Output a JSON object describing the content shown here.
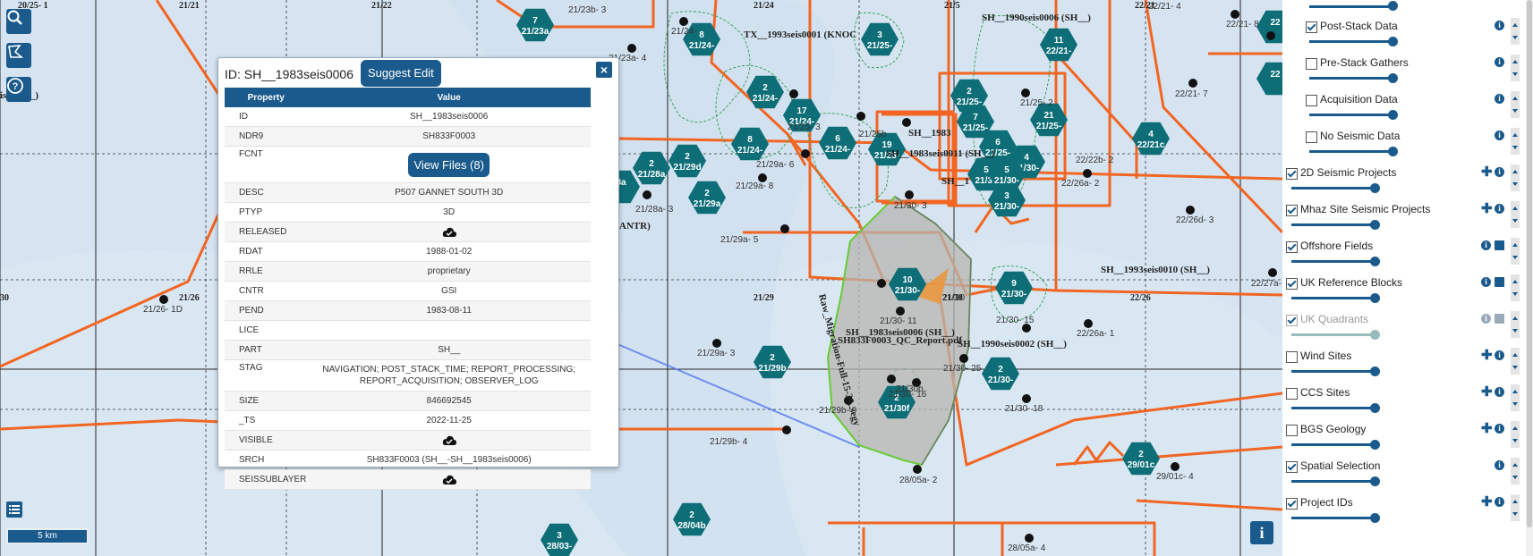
{
  "popup": {
    "title": "ID: SH__1983seis0006",
    "suggest_label": "Suggest Edit",
    "close_label": "×",
    "col_property": "Property",
    "col_value": "Value",
    "view_files_label": "View Files (8)",
    "rows": {
      "id": {
        "k": "ID",
        "v": "SH__1983seis0006"
      },
      "ndr9": {
        "k": "NDR9",
        "v": "SH833F0003"
      },
      "fcnt": {
        "k": "FCNT"
      },
      "desc": {
        "k": "DESC",
        "v": "P507 GANNET SOUTH 3D"
      },
      "ptyp": {
        "k": "PTYP",
        "v": "3D"
      },
      "released": {
        "k": "RELEASED"
      },
      "rdat": {
        "k": "RDAT",
        "v": "1988-01-02"
      },
      "rrle": {
        "k": "RRLE",
        "v": "proprietary"
      },
      "cntr": {
        "k": "CNTR",
        "v": "GSI"
      },
      "pend": {
        "k": "PEND",
        "v": "1983-08-11"
      },
      "lice": {
        "k": "LICE",
        "v": ""
      },
      "part": {
        "k": "PART",
        "v": "SH__"
      },
      "stag": {
        "k": "STAG",
        "v": "NAVIGATION; POST_STACK_TIME; REPORT_PROCESSING; REPORT_ACQUISITION; OBSERVER_LOG"
      },
      "size": {
        "k": "SIZE",
        "v": "846692545"
      },
      "ts": {
        "k": "_TS",
        "v": "2022-11-25"
      },
      "visible": {
        "k": "VISIBLE"
      },
      "srch": {
        "k": "SRCH",
        "v": "SH833F0003 (SH__-SH__1983seis0006)"
      },
      "seissublayer": {
        "k": "SEISSUBLAYER"
      }
    }
  },
  "layers": {
    "post_stack": "Post-Stack Data",
    "pre_stack": "Pre-Stack Gathers",
    "acquisition": "Acquisition Data",
    "no_seismic": "No Seismic Data",
    "seismic_2d": "2D Seismic Projects",
    "mhaz": "Mhaz Site Seismic Projects",
    "offshore": "Offshore Fields",
    "uk_blocks": "UK Reference Blocks",
    "uk_quadrants": "UK Quadrants",
    "wind": "Wind Sites",
    "ccs": "CCS Sites",
    "bgs": "BGS Geology",
    "spatial": "Spatial Selection",
    "project_ids": "Project IDs"
  },
  "map": {
    "scale_label": "5 km",
    "info_label": "i",
    "grid_labels": [
      "21/21",
      "21/22",
      "21/24",
      "21/5",
      "22/21",
      "21/26",
      "21/29",
      "21/30",
      "22/26",
      "20/25- 1",
      "30"
    ],
    "survey_labels": [
      "SH__1990seis0006 (SH__)",
      "TX__1993seis0001 (KNOC",
      "SH__1983seis0011 (SH__)",
      "SH__1993seis0010 (SH__)",
      "SH__1990seis0002 (SH__)",
      "1 (ANTR)",
      "SH833F0003_QC_Report.pdf",
      "SH__1983seis0006 (SH__)",
      "Raw_Migration-Full-15-30..segy",
      "SH__1983",
      "is (SH__)",
      "SH__1"
    ],
    "well_labels": [
      "21/24-",
      "21/23a- 4",
      "21/25- 3",
      "21/25b",
      "21/29a- 6",
      "21/29a- 8",
      "21/28a- 3",
      "21/29a- 5",
      "21/30- 3",
      "21/30- 11",
      "21/30- 16",
      "21/30b",
      "21/30- 25",
      "21/29b- 9",
      "21/29b- 4",
      "21/29a- 3",
      "21/30- 15",
      "21/30- 18",
      "28/05a- 2",
      "28/05a- 4",
      "21/26- 1D",
      "22/22b- 2",
      "22/26a- 2",
      "22/26d- 3",
      "22/26a- 1",
      "22/27a-",
      "22/21- 7",
      "22/21- 8",
      "22/21- 4",
      "21/25- 2",
      "29/01c- 4",
      "21/23b- 3",
      "21/30"
    ],
    "hex_markers": [
      {
        "n": "7",
        "t": "21/23a"
      },
      {
        "n": "8",
        "t": "21/24-"
      },
      {
        "n": "3",
        "t": "21/25-"
      },
      {
        "n": "11",
        "t": "22/21-"
      },
      {
        "n": "2",
        "t": "21/24-"
      },
      {
        "n": "17",
        "t": "21/24-"
      },
      {
        "n": "8",
        "t": "21/24-"
      },
      {
        "n": "6",
        "t": "21/24-"
      },
      {
        "n": "19",
        "t": "21/25-"
      },
      {
        "n": "2",
        "t": "21/25-"
      },
      {
        "n": "7",
        "t": "21/25-"
      },
      {
        "n": "21",
        "t": "21/25-"
      },
      {
        "n": "6",
        "t": "21/25-"
      },
      {
        "n": "4",
        "t": "21/30-"
      },
      {
        "n": "5",
        "t": "21/30"
      },
      {
        "n": "5",
        "t": "21/30-"
      },
      {
        "n": "3",
        "t": "21/30-"
      },
      {
        "n": "4",
        "t": "22/21c"
      },
      {
        "n": "2",
        "t": "21/28a"
      },
      {
        "n": "2",
        "t": "21/29d"
      },
      {
        "n": "2",
        "t": "21/29a"
      },
      {
        "n": "8a",
        "t": ""
      },
      {
        "n": "10",
        "t": "21/30-"
      },
      {
        "n": "9",
        "t": "21/30-"
      },
      {
        "n": "2",
        "t": "21/29b"
      },
      {
        "n": "2",
        "t": "21/30-"
      },
      {
        "n": "2",
        "t": "21/30f"
      },
      {
        "n": "2",
        "t": "29/01c"
      },
      {
        "n": "2",
        "t": "28/04b"
      },
      {
        "n": "3",
        "t": "28/03-"
      },
      {
        "n": "22",
        "t": ""
      },
      {
        "n": "22",
        "t": ""
      }
    ]
  },
  "colors": {
    "accent": "#1a5a8c",
    "marker": "#0e6e78",
    "boundary": "#f26522",
    "field_outline": "#3aa55a",
    "map_background": "#d8e6f2",
    "selection_fill": "#b5b5b0",
    "selection_outline": "#66cc33"
  }
}
